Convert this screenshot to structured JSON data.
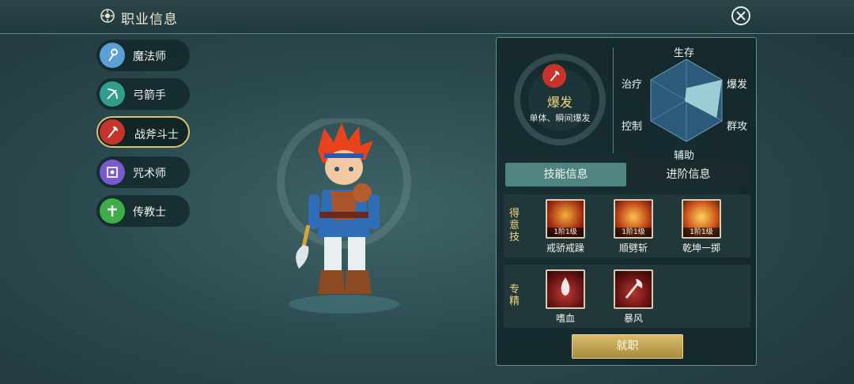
{
  "header": {
    "title": "职业信息"
  },
  "classes": [
    {
      "label": "魔法师",
      "icon": "magic-staff-icon",
      "color": "#5aa0d6"
    },
    {
      "label": "弓箭手",
      "icon": "bow-arrow-icon",
      "color": "#2f9e8c"
    },
    {
      "label": "战斧斗士",
      "icon": "battle-axe-icon",
      "color": "#c7342b",
      "selected": true
    },
    {
      "label": "咒术师",
      "icon": "spell-seal-icon",
      "color": "#7a5ad0"
    },
    {
      "label": "传教士",
      "icon": "holy-cross-icon",
      "color": "#3fae4a"
    }
  ],
  "panel": {
    "type_name": "爆发",
    "type_desc": "单体、瞬间爆发",
    "radar": {
      "axes": [
        "生存",
        "爆发",
        "群攻",
        "辅助",
        "控制",
        "治疗"
      ],
      "values": [
        0.3,
        1.0,
        0.85,
        0.0,
        0.0,
        0.0
      ]
    },
    "tabs": [
      "技能信息",
      "进阶信息"
    ],
    "favored_label": "得意技",
    "favored_skills": [
      {
        "name": "戒骄戒躁",
        "level": "1阶1级"
      },
      {
        "name": "顺劈斩",
        "level": "1阶1级"
      },
      {
        "name": "乾坤一掷",
        "level": "1阶1级"
      }
    ],
    "spec_label": "专精",
    "spec_skills": [
      {
        "name": "嗜血"
      },
      {
        "name": "暴风"
      }
    ],
    "job_button": "就职"
  },
  "colors": {
    "accent": "#f0d77c",
    "tab_active": "#4e8580",
    "button": "#c8ab5a"
  }
}
